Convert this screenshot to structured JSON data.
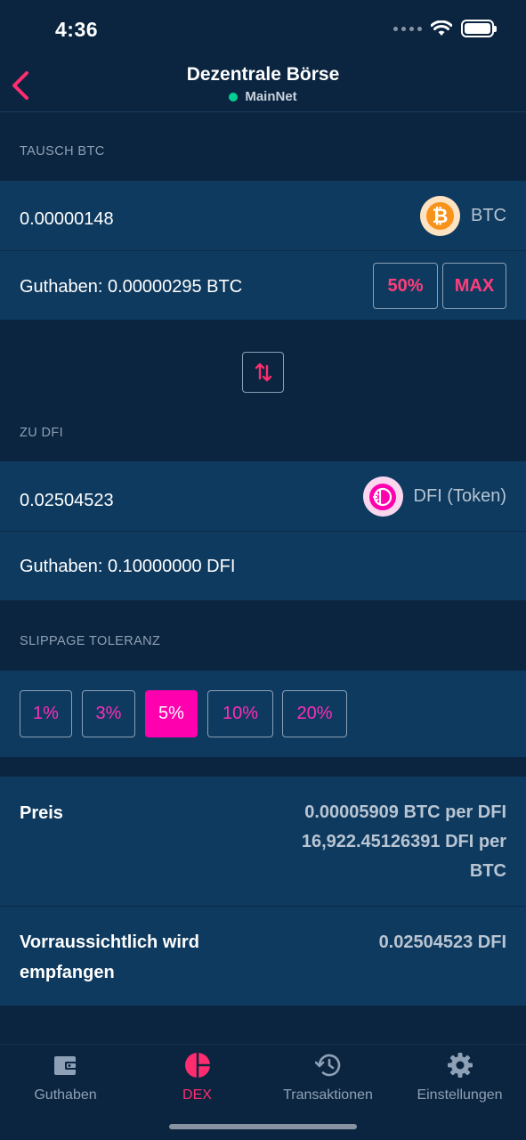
{
  "status": {
    "time": "4:36"
  },
  "header": {
    "title": "Dezentrale Börse",
    "network": "MainNet",
    "network_color": "#02cf92"
  },
  "from": {
    "section_label": "TAUSCH BTC",
    "amount": "0.00000148",
    "token": "BTC",
    "token_icon": "bitcoin-icon",
    "balance": "Guthaben: 0.00000295 BTC",
    "btn_half": "50%",
    "btn_max": "MAX"
  },
  "to": {
    "section_label": "ZU DFI",
    "amount": "0.02504523",
    "token": "DFI (Token)",
    "token_icon": "defichain-icon",
    "balance": "Guthaben: 0.10000000 DFI"
  },
  "slippage": {
    "section_label": "SLIPPAGE TOLERANZ",
    "options": [
      "1%",
      "3%",
      "5%",
      "10%",
      "20%"
    ],
    "selected": "5%"
  },
  "price": {
    "label": "Preis",
    "line1": "0.00005909 BTC per DFI",
    "line2": "16,922.45126391 DFI per",
    "line3": "BTC"
  },
  "estimate": {
    "label_line1": "Vorraussichtlich wird",
    "label_line2": "empfangen",
    "value": "0.02504523 DFI"
  },
  "tabs": [
    {
      "label": "Guthaben",
      "icon": "wallet-icon"
    },
    {
      "label": "DEX",
      "icon": "pie-chart-icon",
      "active": true
    },
    {
      "label": "Transaktionen",
      "icon": "history-icon"
    },
    {
      "label": "Einstellungen",
      "icon": "gear-icon"
    }
  ],
  "colors": {
    "accent": "#ff2d6f",
    "slippage_active": "#ff00af",
    "background": "#0b2540",
    "row": "#0e3a5f"
  }
}
